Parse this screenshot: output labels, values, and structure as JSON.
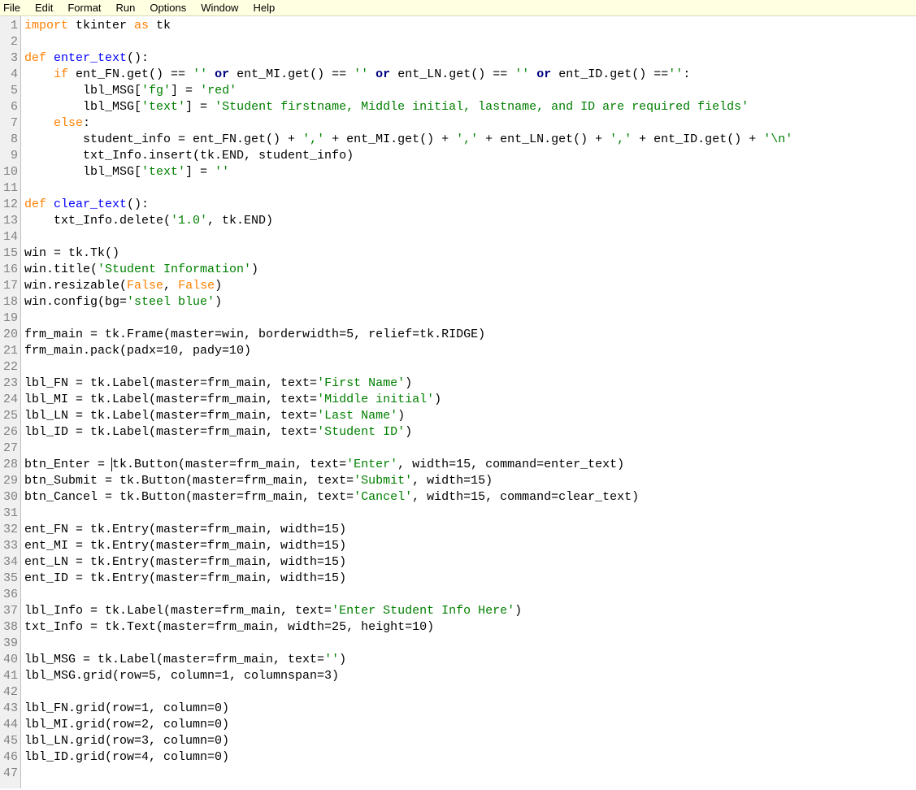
{
  "menu": {
    "file": "File",
    "edit": "Edit",
    "format": "Format",
    "run": "Run",
    "options": "Options",
    "window": "Window",
    "help": "Help"
  },
  "lines": [
    [
      [
        "kw",
        "import"
      ],
      [
        "txt",
        " tkinter "
      ],
      [
        "kw",
        "as"
      ],
      [
        "txt",
        " tk"
      ]
    ],
    [],
    [
      [
        "kw",
        "def"
      ],
      [
        "txt",
        " "
      ],
      [
        "fn",
        "enter_text"
      ],
      [
        "txt",
        "():"
      ]
    ],
    [
      [
        "txt",
        "    "
      ],
      [
        "kw",
        "if"
      ],
      [
        "txt",
        " ent_FN.get() == "
      ],
      [
        "str",
        "''"
      ],
      [
        "txt",
        " "
      ],
      [
        "cond",
        "or"
      ],
      [
        "txt",
        " ent_MI.get() == "
      ],
      [
        "str",
        "''"
      ],
      [
        "txt",
        " "
      ],
      [
        "cond",
        "or"
      ],
      [
        "txt",
        " ent_LN.get() == "
      ],
      [
        "str",
        "''"
      ],
      [
        "txt",
        " "
      ],
      [
        "cond",
        "or"
      ],
      [
        "txt",
        " ent_ID.get() =="
      ],
      [
        "str",
        "''"
      ],
      [
        "txt",
        ":"
      ]
    ],
    [
      [
        "txt",
        "        lbl_MSG["
      ],
      [
        "str",
        "'fg'"
      ],
      [
        "txt",
        "] = "
      ],
      [
        "str",
        "'red'"
      ]
    ],
    [
      [
        "txt",
        "        lbl_MSG["
      ],
      [
        "str",
        "'text'"
      ],
      [
        "txt",
        "] = "
      ],
      [
        "str",
        "'Student firstname, Middle initial, lastname, and ID are required fields'"
      ]
    ],
    [
      [
        "txt",
        "    "
      ],
      [
        "kw",
        "else"
      ],
      [
        "txt",
        ":"
      ]
    ],
    [
      [
        "txt",
        "        student_info = ent_FN.get() + "
      ],
      [
        "str",
        "','"
      ],
      [
        "txt",
        " + ent_MI.get() + "
      ],
      [
        "str",
        "','"
      ],
      [
        "txt",
        " + ent_LN.get() + "
      ],
      [
        "str",
        "','"
      ],
      [
        "txt",
        " + ent_ID.get() + "
      ],
      [
        "str",
        "'\\n'"
      ]
    ],
    [
      [
        "txt",
        "        txt_Info.insert(tk.END, student_info)"
      ]
    ],
    [
      [
        "txt",
        "        lbl_MSG["
      ],
      [
        "str",
        "'text'"
      ],
      [
        "txt",
        "] = "
      ],
      [
        "str",
        "''"
      ]
    ],
    [],
    [
      [
        "kw",
        "def"
      ],
      [
        "txt",
        " "
      ],
      [
        "fn",
        "clear_text"
      ],
      [
        "txt",
        "():"
      ]
    ],
    [
      [
        "txt",
        "    txt_Info.delete("
      ],
      [
        "str",
        "'1.0'"
      ],
      [
        "txt",
        ", tk.END)"
      ]
    ],
    [],
    [
      [
        "txt",
        "win = tk.Tk()"
      ]
    ],
    [
      [
        "txt",
        "win.title("
      ],
      [
        "str",
        "'Student Information'"
      ],
      [
        "txt",
        ")"
      ]
    ],
    [
      [
        "txt",
        "win.resizable("
      ],
      [
        "bool",
        "False"
      ],
      [
        "txt",
        ", "
      ],
      [
        "bool",
        "False"
      ],
      [
        "txt",
        ")"
      ]
    ],
    [
      [
        "txt",
        "win.config(bg="
      ],
      [
        "str",
        "'steel blue'"
      ],
      [
        "txt",
        ")"
      ]
    ],
    [],
    [
      [
        "txt",
        "frm_main = tk.Frame(master=win, borderwidth=5, relief=tk.RIDGE)"
      ]
    ],
    [
      [
        "txt",
        "frm_main.pack(padx=10, pady=10)"
      ]
    ],
    [],
    [
      [
        "txt",
        "lbl_FN = tk.Label(master=frm_main, text="
      ],
      [
        "str",
        "'First Name'"
      ],
      [
        "txt",
        ")"
      ]
    ],
    [
      [
        "txt",
        "lbl_MI = tk.Label(master=frm_main, text="
      ],
      [
        "str",
        "'Middle initial'"
      ],
      [
        "txt",
        ")"
      ]
    ],
    [
      [
        "txt",
        "lbl_LN = tk.Label(master=frm_main, text="
      ],
      [
        "str",
        "'Last Name'"
      ],
      [
        "txt",
        ")"
      ]
    ],
    [
      [
        "txt",
        "lbl_ID = tk.Label(master=frm_main, text="
      ],
      [
        "str",
        "'Student ID'"
      ],
      [
        "txt",
        ")"
      ]
    ],
    [],
    [
      [
        "txt",
        "btn_Enter = "
      ],
      [
        "cursor",
        ""
      ],
      [
        "txt",
        "tk.Button(master=frm_main, text="
      ],
      [
        "str",
        "'Enter'"
      ],
      [
        "txt",
        ", width=15, command=enter_text)"
      ]
    ],
    [
      [
        "txt",
        "btn_Submit = tk.Button(master=frm_main, text="
      ],
      [
        "str",
        "'Submit'"
      ],
      [
        "txt",
        ", width=15)"
      ]
    ],
    [
      [
        "txt",
        "btn_Cancel = tk.Button(master=frm_main, text="
      ],
      [
        "str",
        "'Cancel'"
      ],
      [
        "txt",
        ", width=15, command=clear_text)"
      ]
    ],
    [],
    [
      [
        "txt",
        "ent_FN = tk.Entry(master=frm_main, width=15)"
      ]
    ],
    [
      [
        "txt",
        "ent_MI = tk.Entry(master=frm_main, width=15)"
      ]
    ],
    [
      [
        "txt",
        "ent_LN = tk.Entry(master=frm_main, width=15)"
      ]
    ],
    [
      [
        "txt",
        "ent_ID = tk.Entry(master=frm_main, width=15)"
      ]
    ],
    [],
    [
      [
        "txt",
        "lbl_Info = tk.Label(master=frm_main, text="
      ],
      [
        "str",
        "'Enter Student Info Here'"
      ],
      [
        "txt",
        ")"
      ]
    ],
    [
      [
        "txt",
        "txt_Info = tk.Text(master=frm_main, width=25, height=10)"
      ]
    ],
    [],
    [
      [
        "txt",
        "lbl_MSG = tk.Label(master=frm_main, text="
      ],
      [
        "str",
        "''"
      ],
      [
        "txt",
        ")"
      ]
    ],
    [
      [
        "txt",
        "lbl_MSG.grid(row=5, column=1, columnspan=3)"
      ]
    ],
    [],
    [
      [
        "txt",
        "lbl_FN.grid(row=1, column=0)"
      ]
    ],
    [
      [
        "txt",
        "lbl_MI.grid(row=2, column=0)"
      ]
    ],
    [
      [
        "txt",
        "lbl_LN.grid(row=3, column=0)"
      ]
    ],
    [
      [
        "txt",
        "lbl_ID.grid(row=4, column=0)"
      ]
    ],
    []
  ]
}
